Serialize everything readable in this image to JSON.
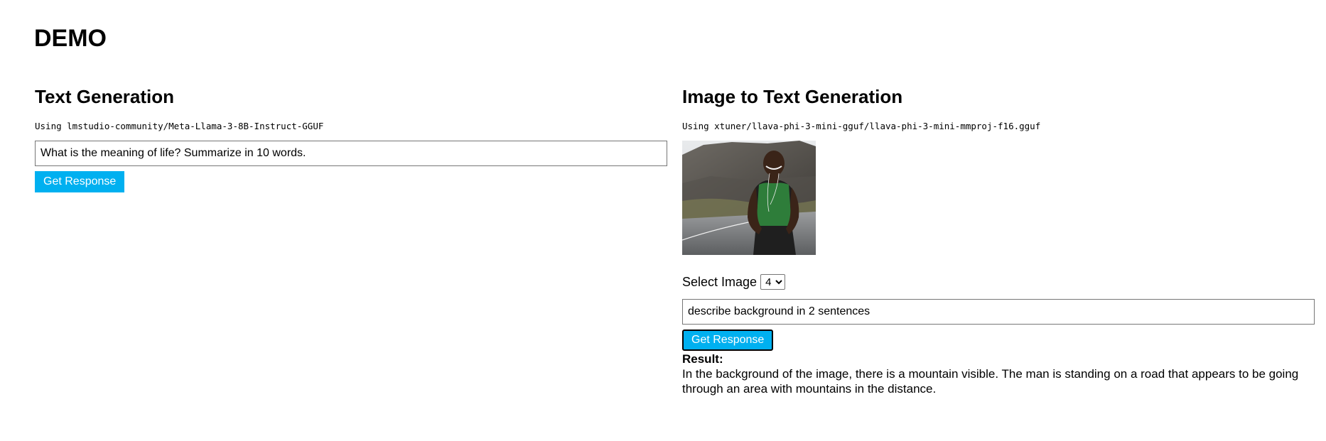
{
  "page": {
    "title": "DEMO"
  },
  "text_generation": {
    "title": "Text Generation",
    "model_line": "Using lmstudio-community/Meta-Llama-3-8B-Instruct-GGUF",
    "prompt_value": "What is the meaning of life? Summarize in 10 words.",
    "button_label": "Get Response"
  },
  "image_to_text": {
    "title": "Image to Text Generation",
    "model_line": "Using xtuner/llava-phi-3-mini-gguf/llava-phi-3-mini-mmproj-f16.gguf",
    "image_description": "man in green tank top on road with mountains behind",
    "select_label": "Select Image",
    "select_value": "4",
    "prompt_value": "describe background in 2 sentences",
    "button_label": "Get Response",
    "result_label": "Result:",
    "result_text": "In the background of the image, there is a mountain visible. The man is standing on a road that appears to be going through an area with mountains in the distance."
  },
  "colors": {
    "button_bg": "#00b0f0",
    "button_text": "#ffffff"
  }
}
